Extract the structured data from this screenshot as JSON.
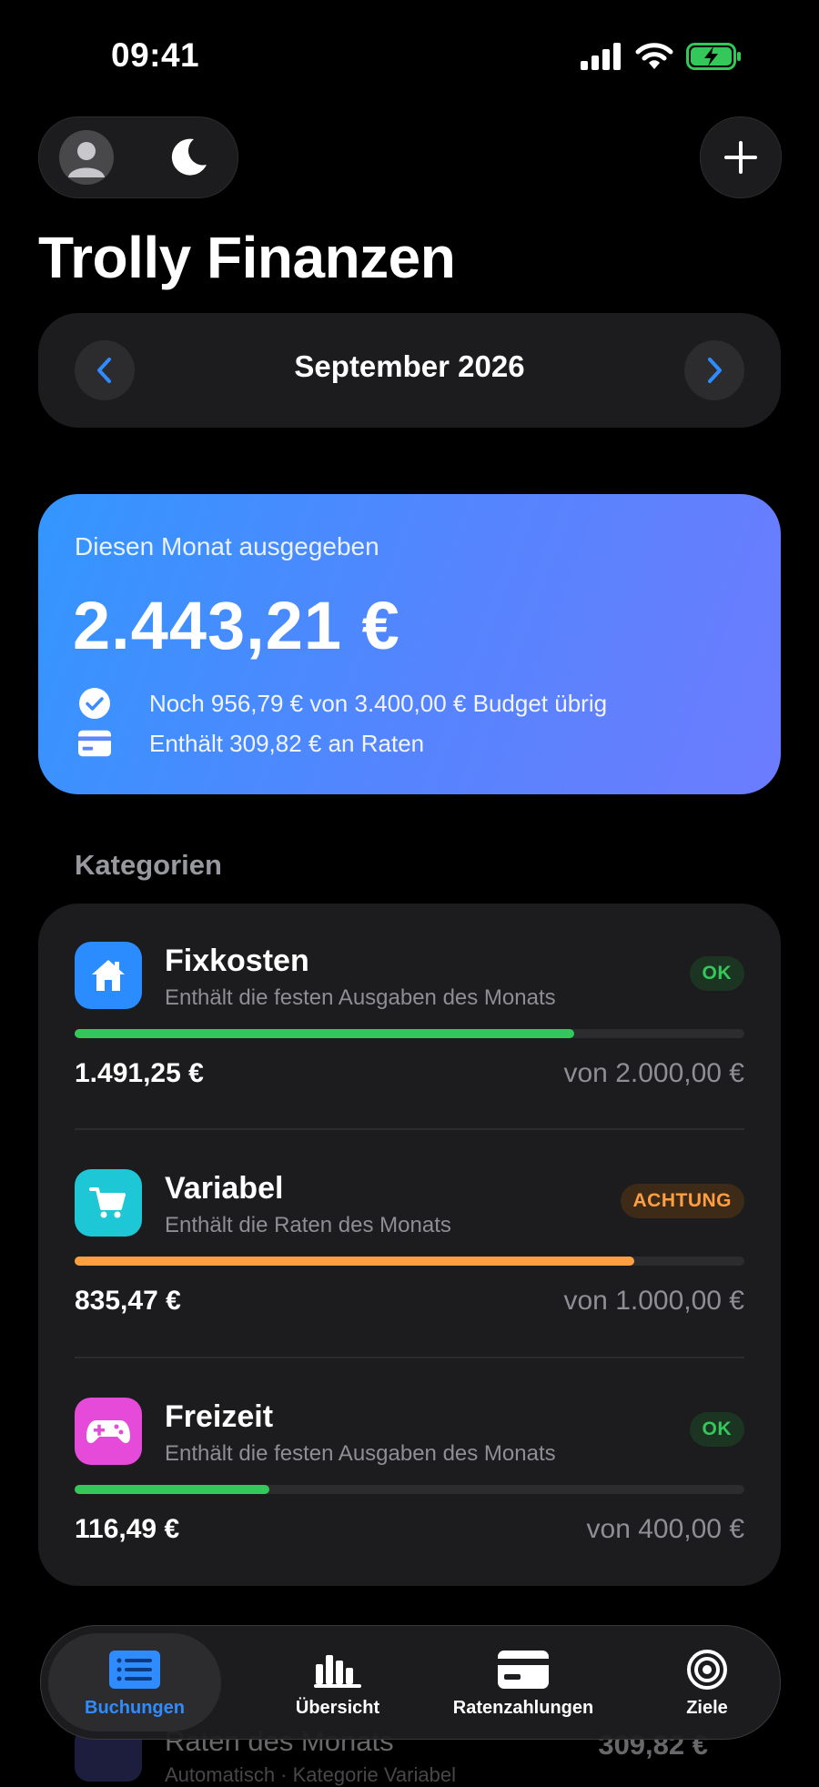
{
  "status_bar": {
    "time": "09:41"
  },
  "app": {
    "title": "Trolly Finanzen"
  },
  "month": {
    "label": "September 2026"
  },
  "summary": {
    "label": "Diesen Monat ausgegeben",
    "amount": "2.443,21 €",
    "budget_line": "Noch 956,79 € von 3.400,00 € Budget übrig",
    "rates_line": "Enthält 309,82 € an Raten"
  },
  "categories": {
    "title": "Kategorien",
    "items": [
      {
        "name": "Fixkosten",
        "desc": "Enthält die festen Ausgaben des Monats",
        "status": "OK",
        "amount": "1.491,25 €",
        "limit": "von 2.000,00 €",
        "progress": 0.746,
        "color": "#34c759",
        "icon": "house-icon",
        "icon_bg": "#2a8cff"
      },
      {
        "name": "Variabel",
        "desc": "Enthält die Raten des Monats",
        "status": "ACHTUNG",
        "amount": "835,47 €",
        "limit": "von 1.000,00 €",
        "progress": 0.835,
        "color": "#ff9f43",
        "icon": "cart-icon",
        "icon_bg": "#1ec7d6"
      },
      {
        "name": "Freizeit",
        "desc": "Enthält die festen Ausgaben des Monats",
        "status": "OK",
        "amount": "116,49 €",
        "limit": "von 400,00 €",
        "progress": 0.291,
        "color": "#34c759",
        "icon": "gamepad-icon",
        "icon_bg": "#e64ad8"
      }
    ]
  },
  "peek": {
    "title": "Raten des Monats",
    "subtitle": "Automatisch · Kategorie Variabel",
    "amount": "309,82 €"
  },
  "tabs": [
    {
      "label": "Buchungen",
      "icon": "list-icon",
      "active": true
    },
    {
      "label": "Übersicht",
      "icon": "bar-chart-icon",
      "active": false
    },
    {
      "label": "Ratenzahlungen",
      "icon": "credit-card-icon",
      "active": false
    },
    {
      "label": "Ziele",
      "icon": "target-icon",
      "active": false
    }
  ],
  "colors": {
    "accent": "#2f8cff",
    "ok": "#34c759",
    "warn": "#ff9f43"
  }
}
